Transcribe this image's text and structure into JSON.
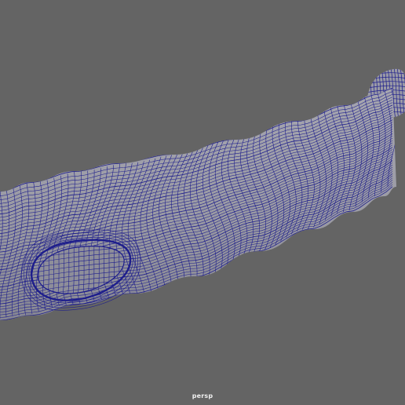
{
  "viewport": {
    "camera_label": "persp",
    "background_color": "#646464",
    "shading": "wireframe-on-shaded"
  },
  "model": {
    "surface_color": "#9c9ca6",
    "wire_color": "#1e1e8c"
  }
}
